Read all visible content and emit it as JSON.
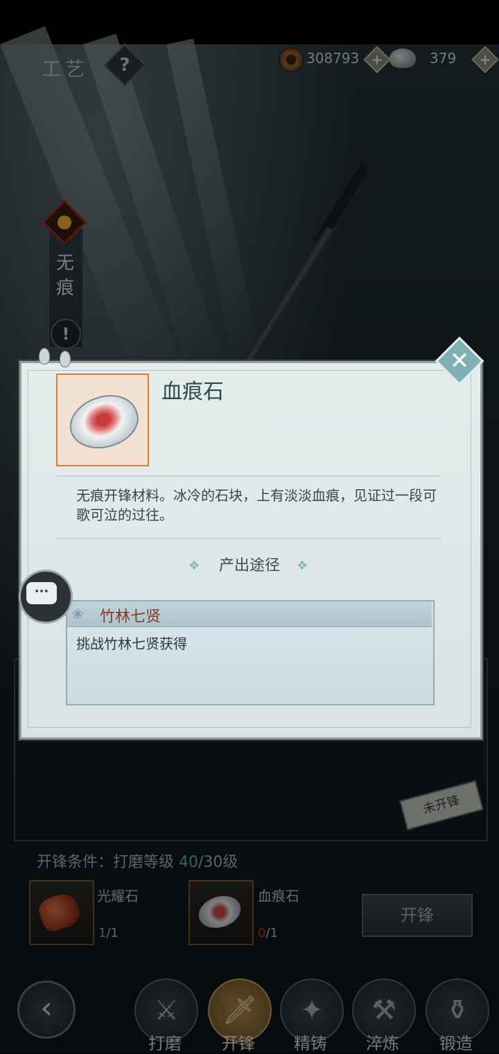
{
  "header": {
    "title": "工艺",
    "help_label": "?",
    "copper_amount": "308793",
    "silver_amount": "379",
    "plus_label": "+"
  },
  "side_tab": {
    "label": "无痕",
    "alert_label": "!"
  },
  "background": {
    "stamp_label": "未开锋"
  },
  "conditions": {
    "prefix": "开锋条件：打磨等级 ",
    "current": "40",
    "suffix": "/30级"
  },
  "materials": [
    {
      "name": "光耀石",
      "have": "1",
      "need": "/1"
    },
    {
      "name": "血痕石",
      "have": "0",
      "need": "/1"
    }
  ],
  "action_button": "开锋",
  "nav": {
    "back_label": "‹",
    "items": [
      {
        "label": "打磨",
        "icon": "grind-icon",
        "active": false
      },
      {
        "label": "开锋",
        "icon": "sharpen-icon",
        "active": true
      },
      {
        "label": "精铸",
        "icon": "refine-icon",
        "active": false
      },
      {
        "label": "淬炼",
        "icon": "temper-icon",
        "active": false
      },
      {
        "label": "锻造",
        "icon": "forge-icon",
        "active": false
      }
    ]
  },
  "modal": {
    "item_name": "血痕石",
    "description": "无痕开锋材料。冰冷的石块，上有淡淡血痕，见证过一段可歌可泣的过往。",
    "source_title": "产出途径",
    "sources": [
      {
        "name": "竹林七贤",
        "desc": "挑战竹林七贤获得"
      }
    ],
    "close_label": "✕",
    "chat_label": "···"
  },
  "colors": {
    "accent_green": "#5fb69a",
    "deficit_red": "#c23a2a",
    "item_frame": "#e07b2c",
    "source_name": "#8a3a22"
  }
}
